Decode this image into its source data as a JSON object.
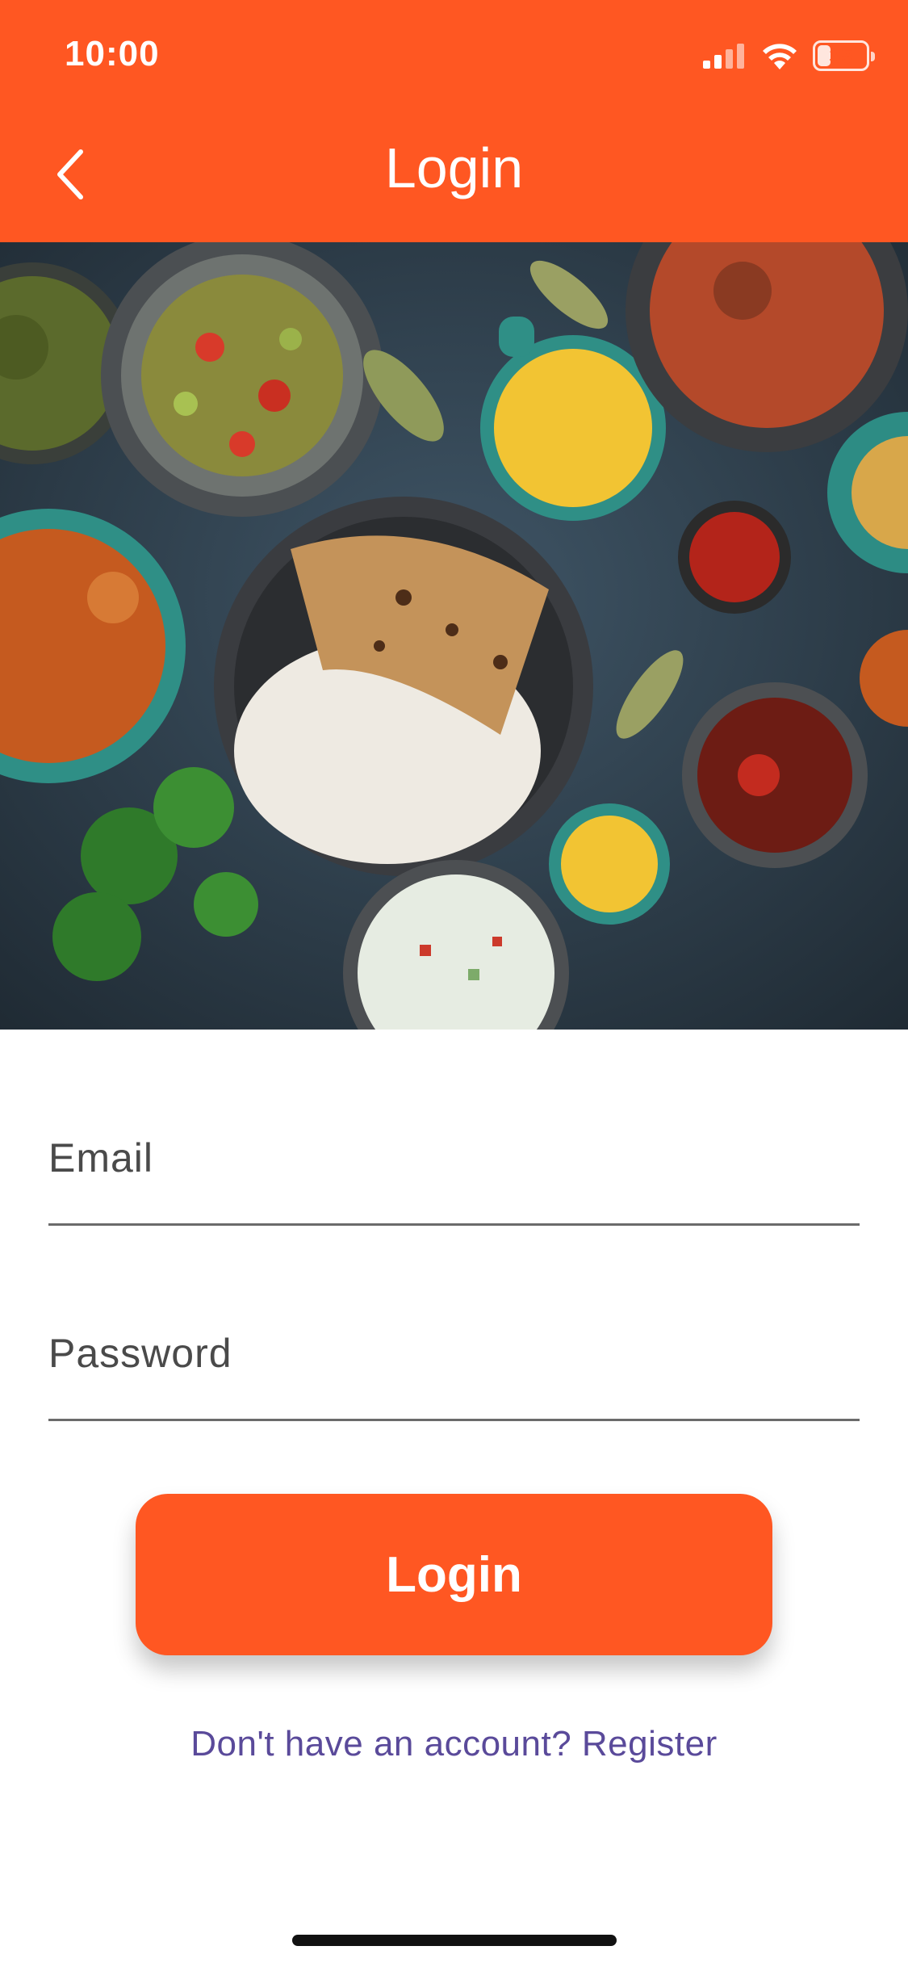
{
  "status_bar": {
    "time": "10:00",
    "battery": "35",
    "battery_level": 0.35,
    "icons": [
      "signal-icon",
      "wifi-icon",
      "battery-icon"
    ]
  },
  "app_bar": {
    "title": "Login",
    "back_icon": "chevron-left-icon"
  },
  "hero": {
    "alt": "Indian food dishes spread on a dark table"
  },
  "form": {
    "email_placeholder": "Email",
    "email_value": "",
    "password_placeholder": "Password",
    "password_value": ""
  },
  "actions": {
    "login_label": "Login",
    "register_prompt": "Don't have an account? Register"
  },
  "colors": {
    "accent": "#ff5722",
    "link": "#5a4a9a"
  }
}
